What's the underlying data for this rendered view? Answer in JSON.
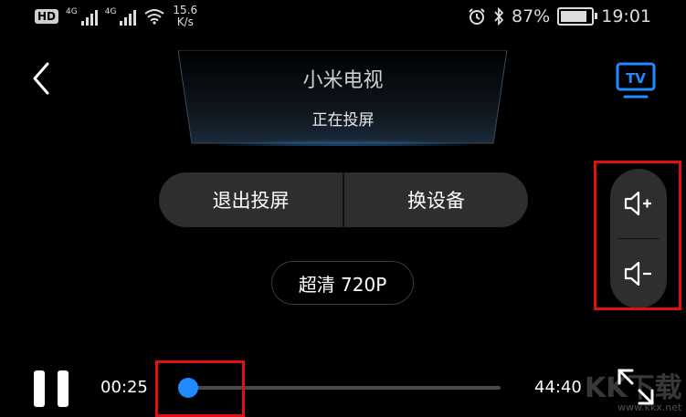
{
  "status_bar": {
    "hd": "HD",
    "signal_1": "4G",
    "signal_2": "4G",
    "speed_value": "15.6",
    "speed_unit": "K/s",
    "battery_percent": "87%",
    "battery_level": 0.87,
    "time": "19:01"
  },
  "header": {
    "device_name": "小米电视",
    "casting_status": "正在投屏"
  },
  "actions": {
    "exit_cast_label": "退出投屏",
    "switch_device_label": "换设备"
  },
  "quality": {
    "label": "超清 720P"
  },
  "player": {
    "elapsed": "00:25",
    "total": "44:40",
    "progress": 0.0093
  },
  "volume": {
    "up_icon": "volume-up-icon",
    "down_icon": "volume-down-icon"
  },
  "watermark": {
    "logo_text": "KK下载",
    "url": "www.kkx.net"
  },
  "colors": {
    "accent": "#1e8cff",
    "highlight": "#e01010",
    "background": "#000000",
    "button_bg": "#2e2e2e"
  }
}
